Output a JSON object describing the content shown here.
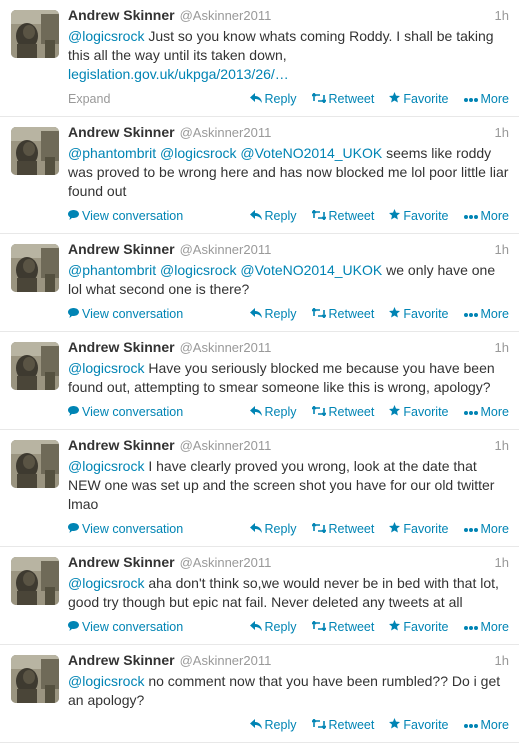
{
  "tweets": [
    {
      "name": "Andrew Skinner",
      "handle": "@Askinner2011",
      "time": "1h",
      "mentions": [
        "@logicsrock"
      ],
      "text": "Just so you know whats coming Roddy. I shall be taking this all the way until its taken down,",
      "link": "legislation.gov.uk/ukpga/2013/26/…",
      "footer_left": "Expand",
      "footer_left_type": "expand"
    },
    {
      "name": "Andrew Skinner",
      "handle": "@Askinner2011",
      "time": "1h",
      "mentions": [
        "@phantombrit",
        "@logicsrock",
        "@VoteNO2014_UKOK"
      ],
      "text": "seems like roddy was proved to be wrong here and has now blocked me lol poor little liar found out",
      "link": "",
      "footer_left": "View conversation",
      "footer_left_type": "conversation"
    },
    {
      "name": "Andrew Skinner",
      "handle": "@Askinner2011",
      "time": "1h",
      "mentions": [
        "@phantombrit",
        "@logicsrock",
        "@VoteNO2014_UKOK"
      ],
      "text": "we only have one lol what second one is there?",
      "link": "",
      "footer_left": "View conversation",
      "footer_left_type": "conversation"
    },
    {
      "name": "Andrew Skinner",
      "handle": "@Askinner2011",
      "time": "1h",
      "mentions": [
        "@logicsrock"
      ],
      "text": "Have you seriously blocked me because you have been found out, attempting to smear someone like this is wrong, apology?",
      "link": "",
      "footer_left": "View conversation",
      "footer_left_type": "conversation"
    },
    {
      "name": "Andrew Skinner",
      "handle": "@Askinner2011",
      "time": "1h",
      "mentions": [
        "@logicsrock"
      ],
      "text": "I have clearly proved you wrong, look at the date that NEW one was set up and the screen shot you have for our old twitter lmao",
      "link": "",
      "footer_left": "View conversation",
      "footer_left_type": "conversation"
    },
    {
      "name": "Andrew Skinner",
      "handle": "@Askinner2011",
      "time": "1h",
      "mentions": [
        "@logicsrock"
      ],
      "text": "aha don't think so,we would never be in bed with that lot, good try though but epic nat fail. Never deleted any tweets at all",
      "link": "",
      "footer_left": "View conversation",
      "footer_left_type": "conversation"
    },
    {
      "name": "Andrew Skinner",
      "handle": "@Askinner2011",
      "time": "1h",
      "mentions": [
        "@logicsrock"
      ],
      "text": "no comment now that you have been rumbled?? Do i get an apology?",
      "link": "",
      "footer_left": "",
      "footer_left_type": "none"
    }
  ],
  "actions": {
    "reply": "Reply",
    "retweet": "Retweet",
    "favorite": "Favorite",
    "more": "More"
  },
  "colors": {
    "link": "#0084b4",
    "muted": "#999999",
    "text": "#333333"
  }
}
